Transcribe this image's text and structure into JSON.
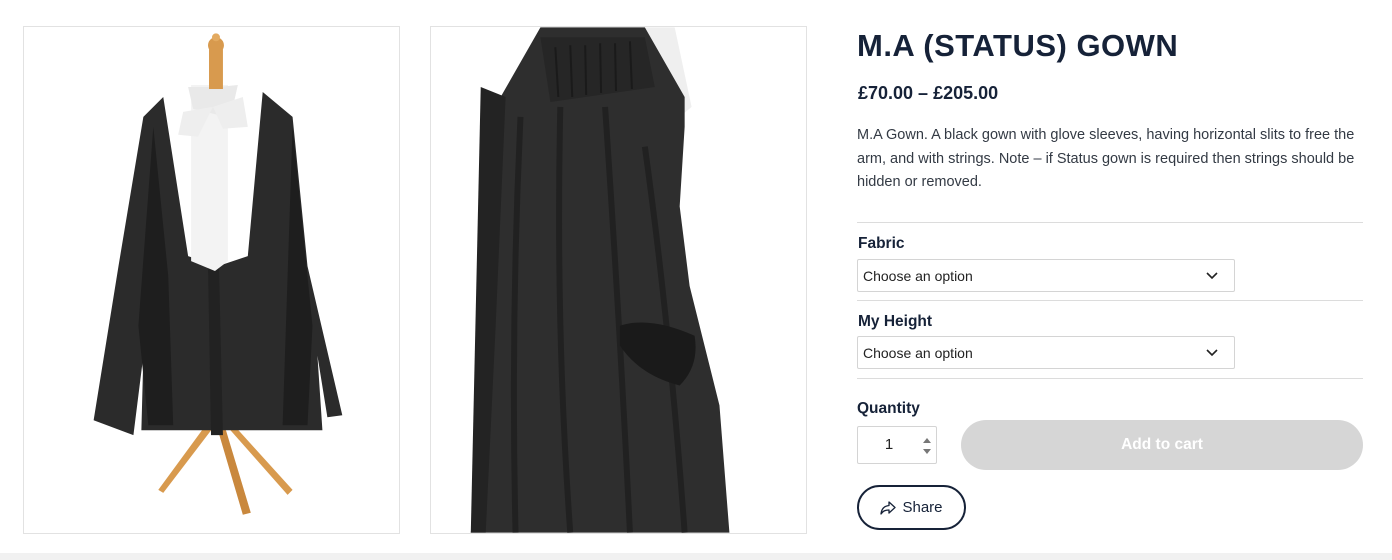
{
  "product": {
    "title": "M.A (STATUS) GOWN",
    "price": "£70.00 – £205.00",
    "description": "M.A Gown. A black gown with glove sleeves, having horizontal slits to free the arm, and with strings.  Note – if Status gown is required then strings should be hidden or removed."
  },
  "options": {
    "fabric": {
      "label": "Fabric",
      "selected": "Choose an option"
    },
    "height": {
      "label": "My Height",
      "selected": "Choose an option"
    }
  },
  "quantity": {
    "label": "Quantity",
    "value": "1"
  },
  "actions": {
    "add_to_cart": "Add to cart",
    "share": "Share"
  },
  "icons": {
    "select_arrow": "chevron-down-icon",
    "stepper": "up-down-arrows-icon",
    "share": "share-arrow-icon"
  },
  "colors": {
    "text_dark": "#162238",
    "disabled_button": "#d6d6d6",
    "gown": "#2a2a2a"
  }
}
